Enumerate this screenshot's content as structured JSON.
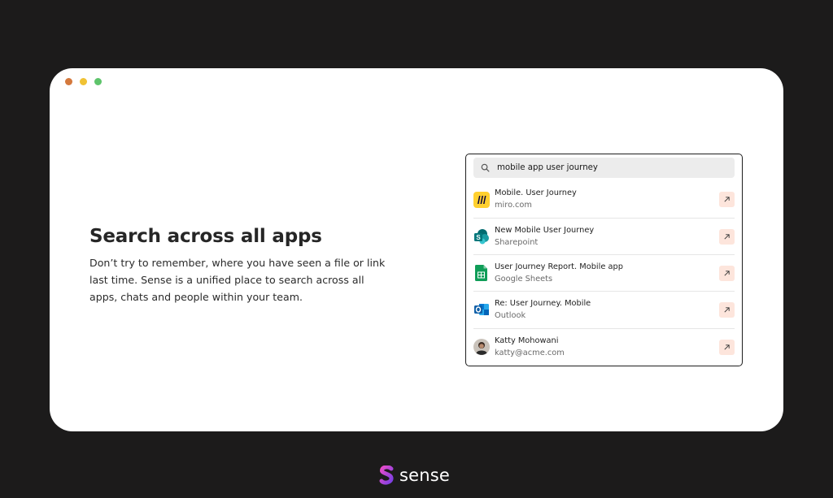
{
  "window": {
    "controls": [
      "close",
      "minimize",
      "maximize"
    ]
  },
  "hero": {
    "heading": "Search across all apps",
    "body": "Don’t try to remember, where you have seen a file or link last time. Sense is a unified place to search across all apps, chats and people within your team."
  },
  "search": {
    "query": "mobile app user journey",
    "icon": "search-icon"
  },
  "results": [
    {
      "title": "Mobile. User Journey",
      "source": "miro.com",
      "icon": "miro-icon"
    },
    {
      "title": "New Mobile User Journey",
      "source": "Sharepoint",
      "icon": "sharepoint-icon"
    },
    {
      "title": "User Journey Report. Mobile app",
      "source": "Google Sheets",
      "icon": "google-sheets-icon"
    },
    {
      "title": "Re: User Journey. Mobile",
      "source": "Outlook",
      "icon": "outlook-icon"
    },
    {
      "title": "Katty Mohowani",
      "source": "katty@acme.com",
      "icon": "avatar"
    }
  ],
  "brand": {
    "name": "sense",
    "accent_colors": [
      "#7b3fe4",
      "#e94cc8"
    ]
  },
  "colors": {
    "background": "#1c1b1b",
    "open_button": "#fde5dc",
    "dot_red": "#d4793d",
    "dot_yellow": "#f0c234",
    "dot_green": "#5ec46b"
  }
}
